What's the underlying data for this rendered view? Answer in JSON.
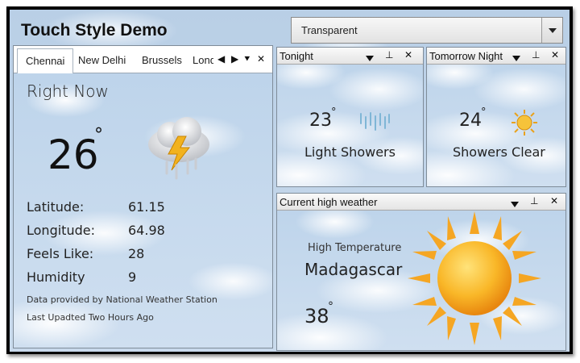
{
  "app": {
    "title": "Touch Style Demo"
  },
  "theme_select": {
    "value": "Transparent"
  },
  "left_pane": {
    "tabs": [
      "Chennai",
      "New Delhi",
      "Brussels",
      "London"
    ],
    "active_tab": "Chennai",
    "tab_controls": {
      "prev": "◀",
      "next": "▶",
      "menu": "⯆",
      "close": "✕"
    },
    "heading": "Right Now",
    "temperature": "26",
    "degree": "°",
    "condition_icon": "thunderstorm-cloud-icon",
    "rows": [
      {
        "label": "Latitude:",
        "value": "61.15"
      },
      {
        "label": "Longitude:",
        "value": "64.98"
      },
      {
        "label": "Feels Like:",
        "value": "28"
      },
      {
        "label": "Humidity",
        "value": "9"
      }
    ],
    "source_note": "Data provided by National Weather Station",
    "updated_note": "Last Upadted Two Hours Ago"
  },
  "panels": {
    "tonight": {
      "title": "Tonight",
      "temperature": "23",
      "degree": "°",
      "condition": "Light Showers",
      "icon": "rain-icon"
    },
    "tomorrow_night": {
      "title": "Tomorrow Night",
      "temperature": "24",
      "degree": "°",
      "condition": "Showers Clear",
      "icon": "sun-small-icon"
    },
    "current_high": {
      "title": "Current high weather",
      "label": "High Temperature",
      "place": "Madagascar",
      "temperature": "38",
      "degree": "°",
      "icon": "sun-large-icon"
    }
  },
  "panel_controls": {
    "pin": "⊥",
    "close": "✕"
  },
  "colors": {
    "sky": "#c9daec",
    "sun": "#f7a81b",
    "bolt": "#f2b21e"
  }
}
